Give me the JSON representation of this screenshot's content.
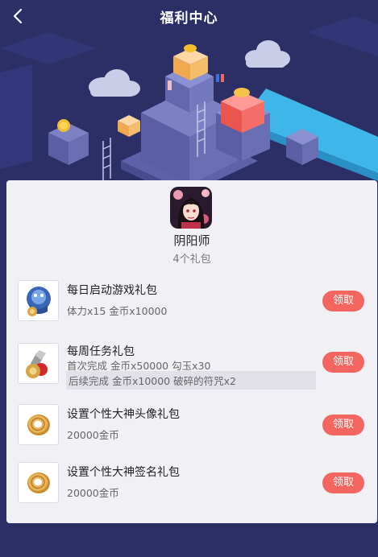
{
  "header": {
    "title": "福利中心"
  },
  "game": {
    "name": "阴阳师",
    "gift_count": "4个礼包"
  },
  "gifts": [
    {
      "title": "每日启动游戏礼包",
      "lines": [
        "体力x15 金币x10000"
      ],
      "claim": "领取"
    },
    {
      "title": "每周任务礼包",
      "lines": [
        "首次完成 金币x50000 勾玉x30",
        "后续完成 金币x10000 破碎的符咒x2"
      ],
      "claim": "领取"
    },
    {
      "title": "设置个性大神头像礼包",
      "lines": [
        "20000金币"
      ],
      "claim": "领取"
    },
    {
      "title": "设置个性大神签名礼包",
      "lines": [
        "20000金币"
      ],
      "claim": "领取"
    }
  ],
  "colors": {
    "background": "#2b2f66",
    "card": "#f1f0f5",
    "claim_button": "#f36660",
    "accent_blue": "#3fb6ea"
  }
}
